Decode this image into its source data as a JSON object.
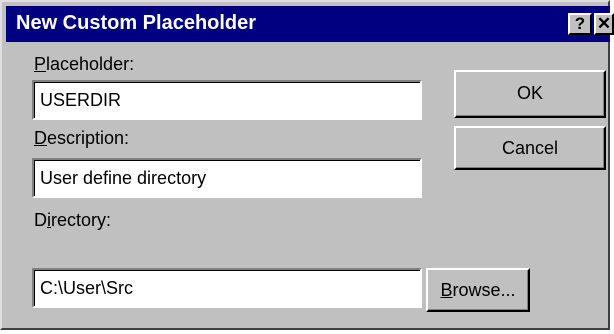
{
  "dialog": {
    "title": "New Custom Placeholder",
    "help_glyph": "?",
    "close_glyph": "✕"
  },
  "placeholder": {
    "label_hotkey": "P",
    "label_rest": "laceholder:",
    "value": "USERDIR"
  },
  "description": {
    "label_hotkey": "D",
    "label_rest": "escription:",
    "value": "User define directory"
  },
  "directory": {
    "label_pre": "D",
    "label_hotkey": "i",
    "label_rest": "rectory:",
    "value": "C:\\User\\Src"
  },
  "buttons": {
    "ok": "OK",
    "cancel": "Cancel",
    "browse_hotkey": "B",
    "browse_rest": "rowse..."
  },
  "icons": {
    "help": "question-mark-icon",
    "close": "close-icon"
  }
}
